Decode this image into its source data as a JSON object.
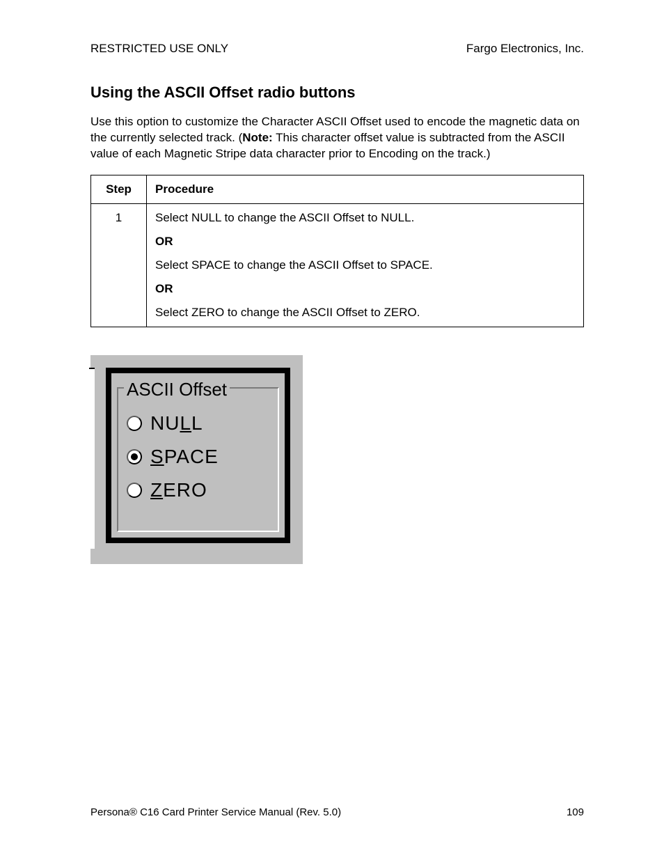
{
  "header": {
    "left": "RESTRICTED USE ONLY",
    "right": "Fargo Electronics, Inc."
  },
  "section_title": "Using the ASCII Offset radio buttons",
  "paragraph": {
    "pre": "Use this option to customize the Character ASCII Offset used to encode the magnetic data on the currently selected track. (",
    "note_label": "Note:",
    "post": "  This character offset value is subtracted from the ASCII value of each Magnetic Stripe data character prior to Encoding on the track.)"
  },
  "table": {
    "headers": {
      "step": "Step",
      "procedure": "Procedure"
    },
    "row": {
      "step": "1",
      "lines": [
        "Select NULL to change the ASCII Offset to NULL.",
        "OR",
        "Select SPACE to change the ASCII Offset to SPACE.",
        "OR",
        "Select ZERO to change the ASCII Offset to ZERO."
      ]
    }
  },
  "radio_group": {
    "legend": "ASCII Offset",
    "options": [
      {
        "label_pre": "NU",
        "label_u": "L",
        "label_post": "L",
        "selected": false
      },
      {
        "label_pre": "",
        "label_u": "S",
        "label_post": "PACE",
        "selected": true
      },
      {
        "label_pre": "",
        "label_u": "Z",
        "label_post": "ERO",
        "selected": false
      }
    ]
  },
  "footer": {
    "left": "Persona® C16 Card Printer Service Manual (Rev. 5.0)",
    "right": "109"
  }
}
